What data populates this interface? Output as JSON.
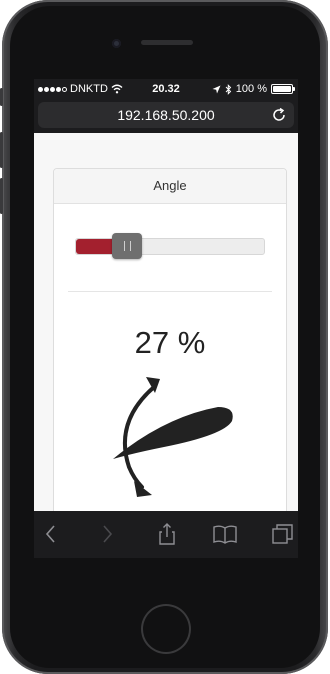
{
  "status": {
    "carrier": "DNKTD",
    "time": "20.32",
    "battery": "100 %",
    "signal_bars": 4,
    "signal_total": 5
  },
  "browser": {
    "url": "192.168.50.200"
  },
  "panel": {
    "title": "Angle",
    "slider_value": 27,
    "percent_label": "27 %"
  },
  "colors": {
    "accent": "#a3202e",
    "handle": "#6f6f6f"
  },
  "icons": {
    "wifi": "wifi-icon",
    "location": "location-arrow-icon",
    "bluetooth": "bluetooth-icon",
    "reload": "reload-icon",
    "back": "chevron-left-icon",
    "forward": "chevron-right-icon",
    "share": "share-icon",
    "bookmarks": "book-icon",
    "tabs": "tabs-icon"
  }
}
